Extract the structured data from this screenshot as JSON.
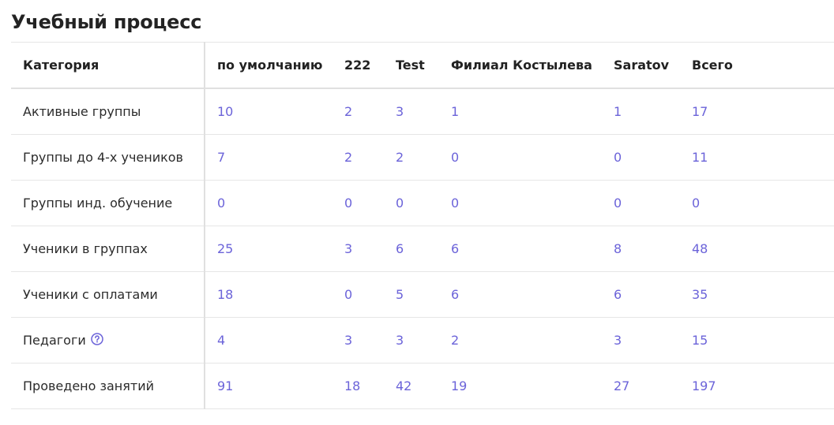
{
  "title": "Учебный процесс",
  "table": {
    "headers": [
      "Категория",
      "по умолчанию",
      "222",
      "Test",
      "Филиал Костылева",
      "Saratov",
      "Всего"
    ],
    "rows": [
      {
        "label": "Активные группы",
        "values": [
          "10",
          "2",
          "3",
          "1",
          "1",
          "17"
        ]
      },
      {
        "label": "Группы до 4-х учеников",
        "values": [
          "7",
          "2",
          "2",
          "0",
          "0",
          "11"
        ]
      },
      {
        "label": "Группы инд. обучение",
        "values": [
          "0",
          "0",
          "0",
          "0",
          "0",
          "0"
        ]
      },
      {
        "label": "Ученики в группах",
        "values": [
          "25",
          "3",
          "6",
          "6",
          "8",
          "48"
        ]
      },
      {
        "label": "Ученики с оплатами",
        "values": [
          "18",
          "0",
          "5",
          "6",
          "6",
          "35"
        ]
      },
      {
        "label": "Педагоги",
        "values": [
          "4",
          "3",
          "3",
          "2",
          "3",
          "15"
        ],
        "icon": "help-circle-icon"
      },
      {
        "label": "Проведено занятий",
        "values": [
          "91",
          "18",
          "42",
          "19",
          "27",
          "197"
        ]
      }
    ]
  },
  "colors": {
    "link": "#6b63d9",
    "text": "#222222",
    "border": "#e6e6e6"
  }
}
